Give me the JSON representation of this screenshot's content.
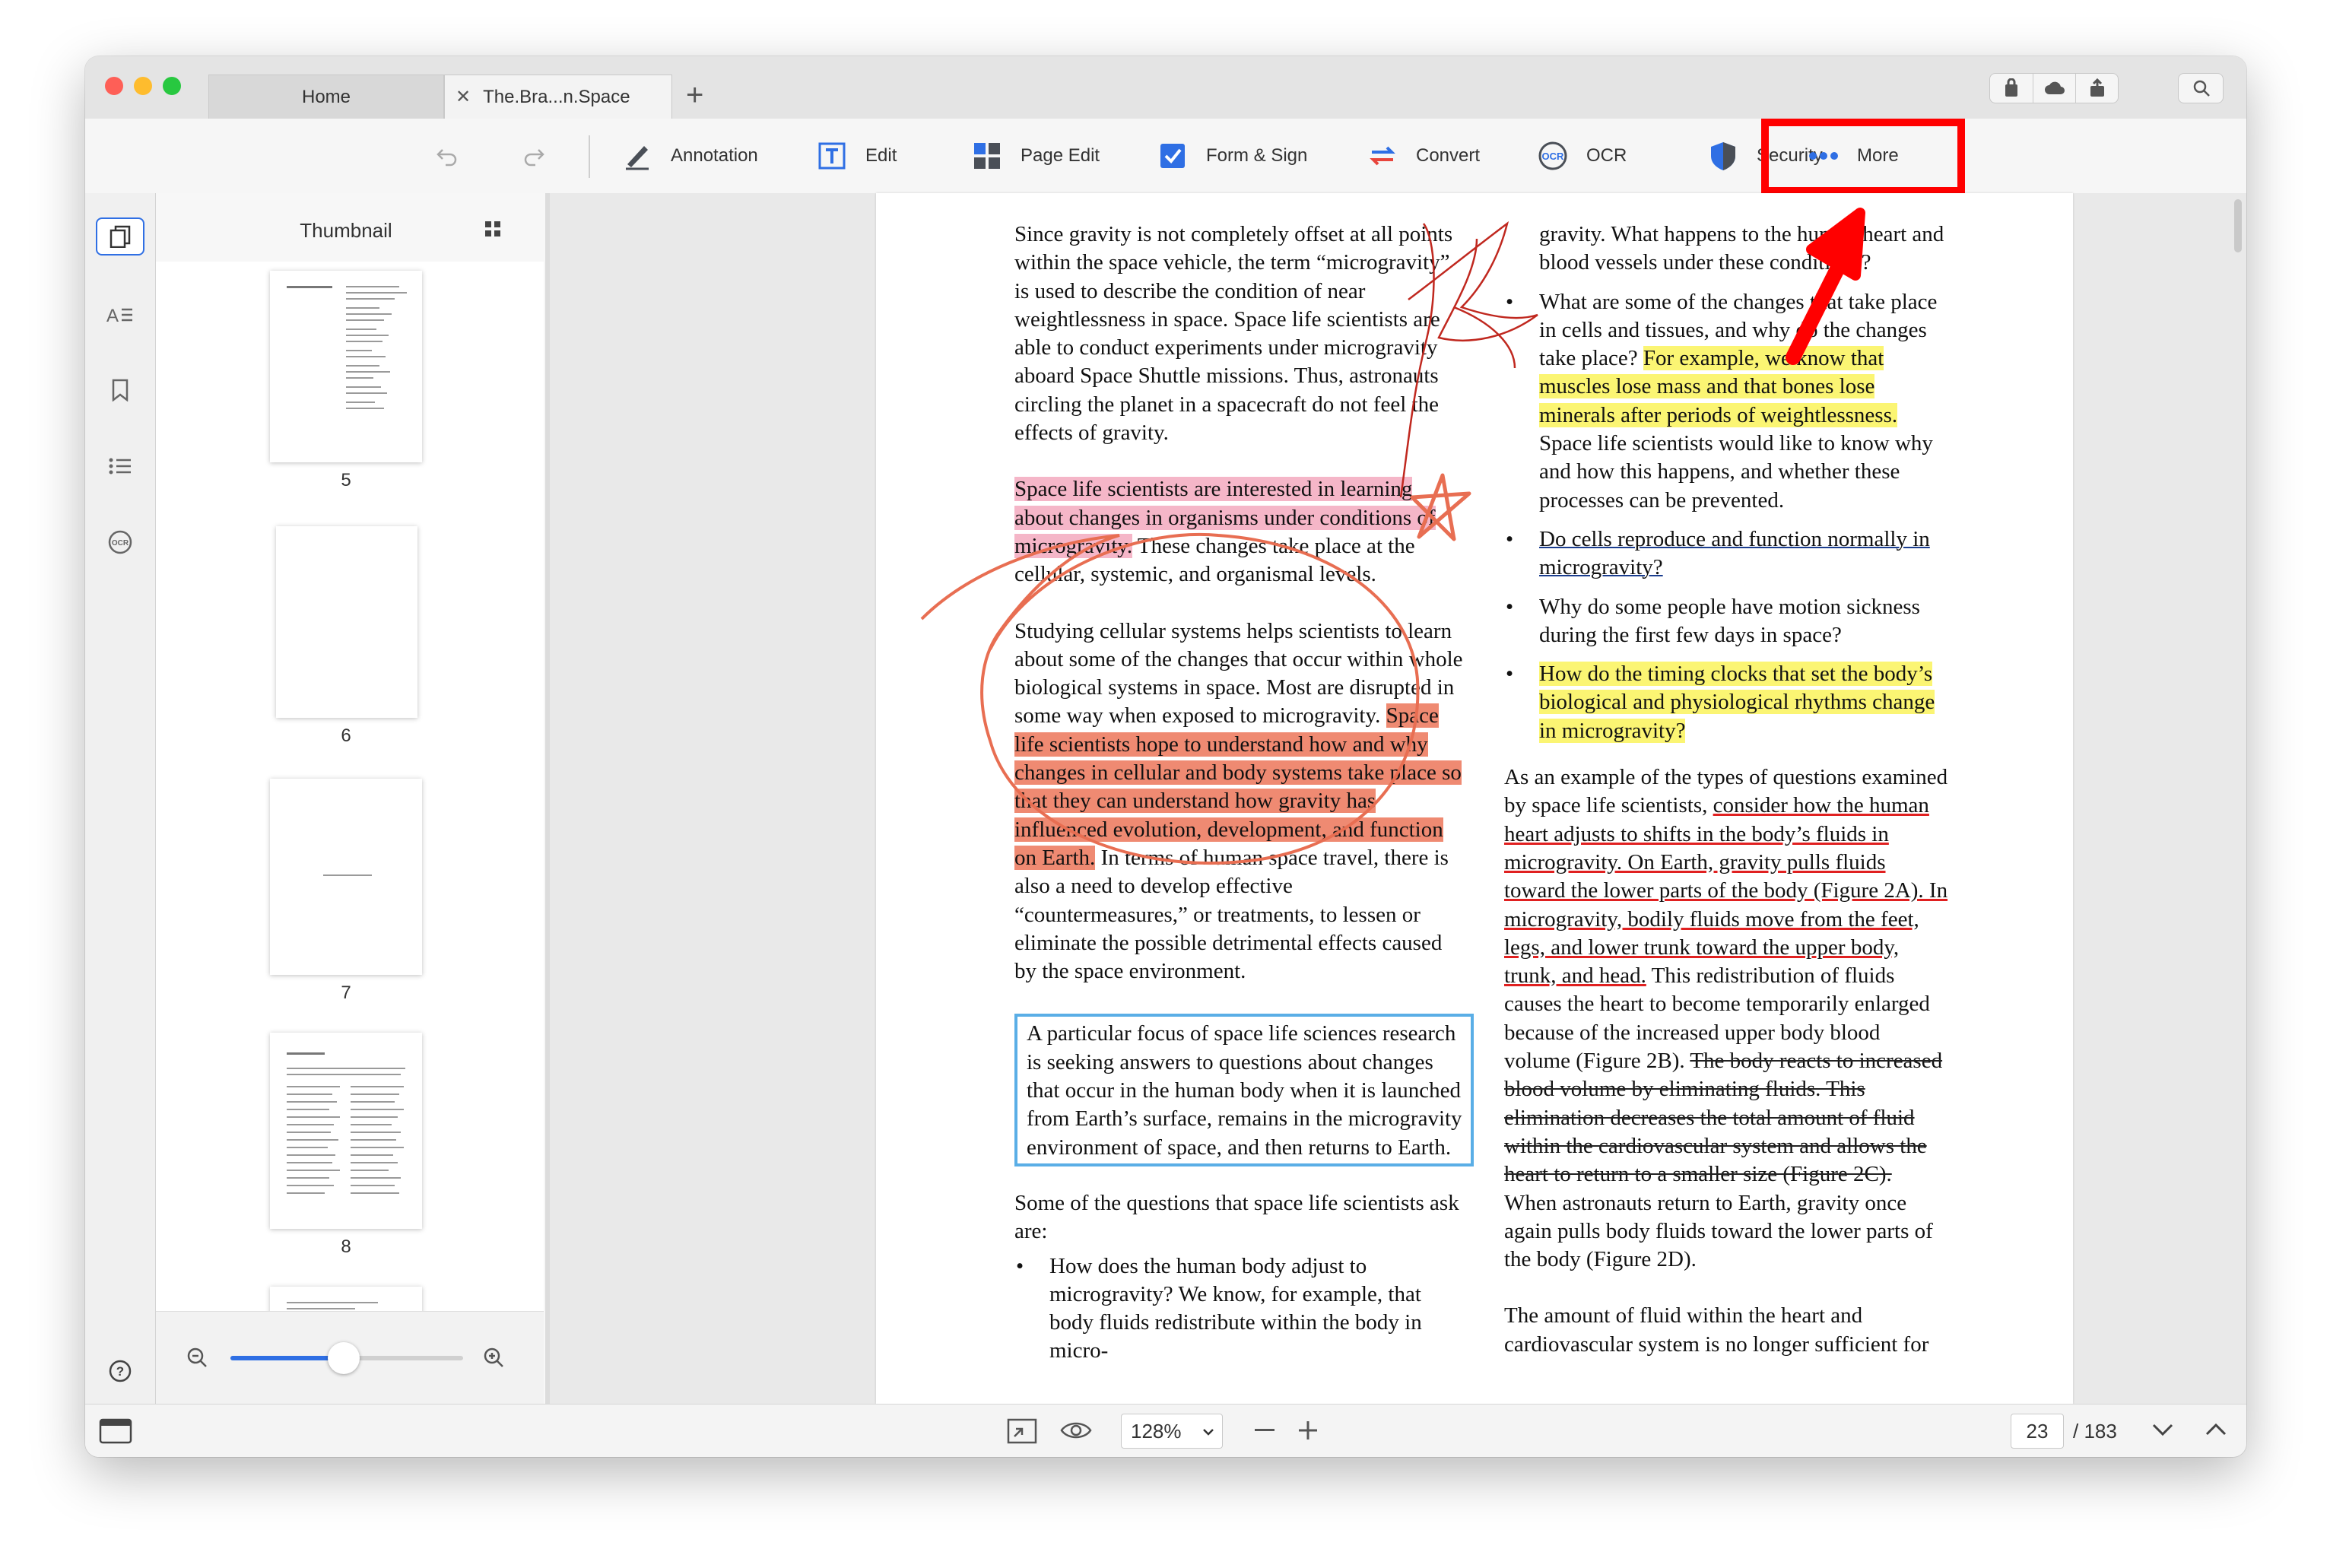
{
  "window": {
    "tabs": [
      {
        "label": "Home",
        "active": false
      },
      {
        "label": "The.Bra...n.Space",
        "active": true
      }
    ],
    "new_tab": "+",
    "close_glyph": "✕"
  },
  "toolbar": {
    "items": [
      {
        "label": "Annotation",
        "icon": "pen-icon"
      },
      {
        "label": "Edit",
        "icon": "text-edit-icon"
      },
      {
        "label": "Page Edit",
        "icon": "grid-icon"
      },
      {
        "label": "Form & Sign",
        "icon": "checkbox-icon"
      },
      {
        "label": "Convert",
        "icon": "convert-icon"
      },
      {
        "label": "OCR",
        "icon": "ocr-icon"
      },
      {
        "label": "Security",
        "icon": "shield-icon"
      },
      {
        "label": "More",
        "icon": "dots-icon"
      }
    ],
    "accent": "#2f6fe4"
  },
  "sidebar": {
    "title": "Thumbnail",
    "thumbnails": [
      {
        "page": "5"
      },
      {
        "page": "6"
      },
      {
        "page": "7"
      },
      {
        "page": "8"
      }
    ]
  },
  "document": {
    "left_column": {
      "p1": "Since gravity is not completely offset at all points within the space vehicle, the term “microgravity” is used to describe the condition of near weightlessness in space. Space life scientists are able to conduct experiments under microgravity aboard Space Shuttle missions. Thus, astronauts circling the planet in a spacecraft do not feel the effects of gravity.",
      "p2_highlight": "Space life scientists are interested in learning about changes in organisms under conditions of microgravity.",
      "p2_rest": " These changes take place at the cellular, systemic, and organismal levels.",
      "p3_start": "Studying cellular systems helps scientists to learn about some of the changes that occur within whole biological systems in space. Most are disrupted in some way when exposed to microgravity. ",
      "p3_highlight": "Space life scientists hope to understand how and why changes in cellular and body systems take place so that they can understand how gravity has influenced evolution, development, and function on Earth.",
      "p3_end": " In terms of human space travel, there is also a need to develop effective “countermeasures,” or treatments, to lessen or eliminate the possible detrimental effects caused by the space environment.",
      "p4_boxed": "A particular focus of space life sciences research is seeking answers to questions about changes that occur in the human body when it is launched from Earth’s surface, remains in the microgravity environment of space, and then returns to Earth.",
      "p5": "Some of the questions that space life scientists ask are:",
      "bullet1": "How does the human body adjust to microgravity? We know, for example, that body fluids redistribute within the body in micro-"
    },
    "right_column": {
      "cont": "gravity. What happens to the human heart and blood vessels under these conditions?",
      "b2_start": "What are some of the changes that take place in cells and tissues, and why do the changes take place? ",
      "b2_highlight": "For example, we know that muscles lose mass and that bones lose minerals after periods of weightlessness.",
      "b2_end": " Space life scientists would like to know why and how this happens, and whether these processes can be prevented.",
      "b3_underline": "Do cells reproduce and function normally in microgravity?",
      "b4": "Why do some people have motion sickness during the first few days in space?",
      "b5_highlight": "How do the timing clocks that set the body’s biological and physiological rhythms change in microgravity?",
      "p6_start": "As an example of the types of questions examined by space life scientists, ",
      "p6_underline": "consider how the human heart adjusts to shifts in the body’s fluids in microgravity. On Earth, gravity pulls fluids toward the lower parts of the body (Figure 2A). In microgravity, bodily fluids move from the feet, legs, and lower trunk toward the upper body, trunk, and head.",
      "p6_mid": " This redistribution of fluids causes the heart to become temporarily enlarged because of the increased upper body blood volume (Figure 2B). ",
      "p6_strike": "The body reacts to increased blood volume by eliminating fluids. This elimination decreases the total amount of fluid within the cardiovascular system and allows the heart to return to a smaller size (Figure 2C).",
      "p6_end": " When astronauts return to Earth, gravity once again pulls body fluids toward the lower parts of the body (Figure 2D).",
      "p7": "The amount of fluid within the heart and cardiovascular system is no longer sufficient for"
    }
  },
  "status": {
    "zoom": "128%",
    "current_page": "23",
    "total_pages": "/ 183"
  },
  "colors": {
    "highlight_pink": "#f5b6c8",
    "highlight_red": "#ef8a72",
    "highlight_yellow": "#fbf573",
    "callout_red": "#ff0000",
    "blue_box": "#5aaee6"
  }
}
